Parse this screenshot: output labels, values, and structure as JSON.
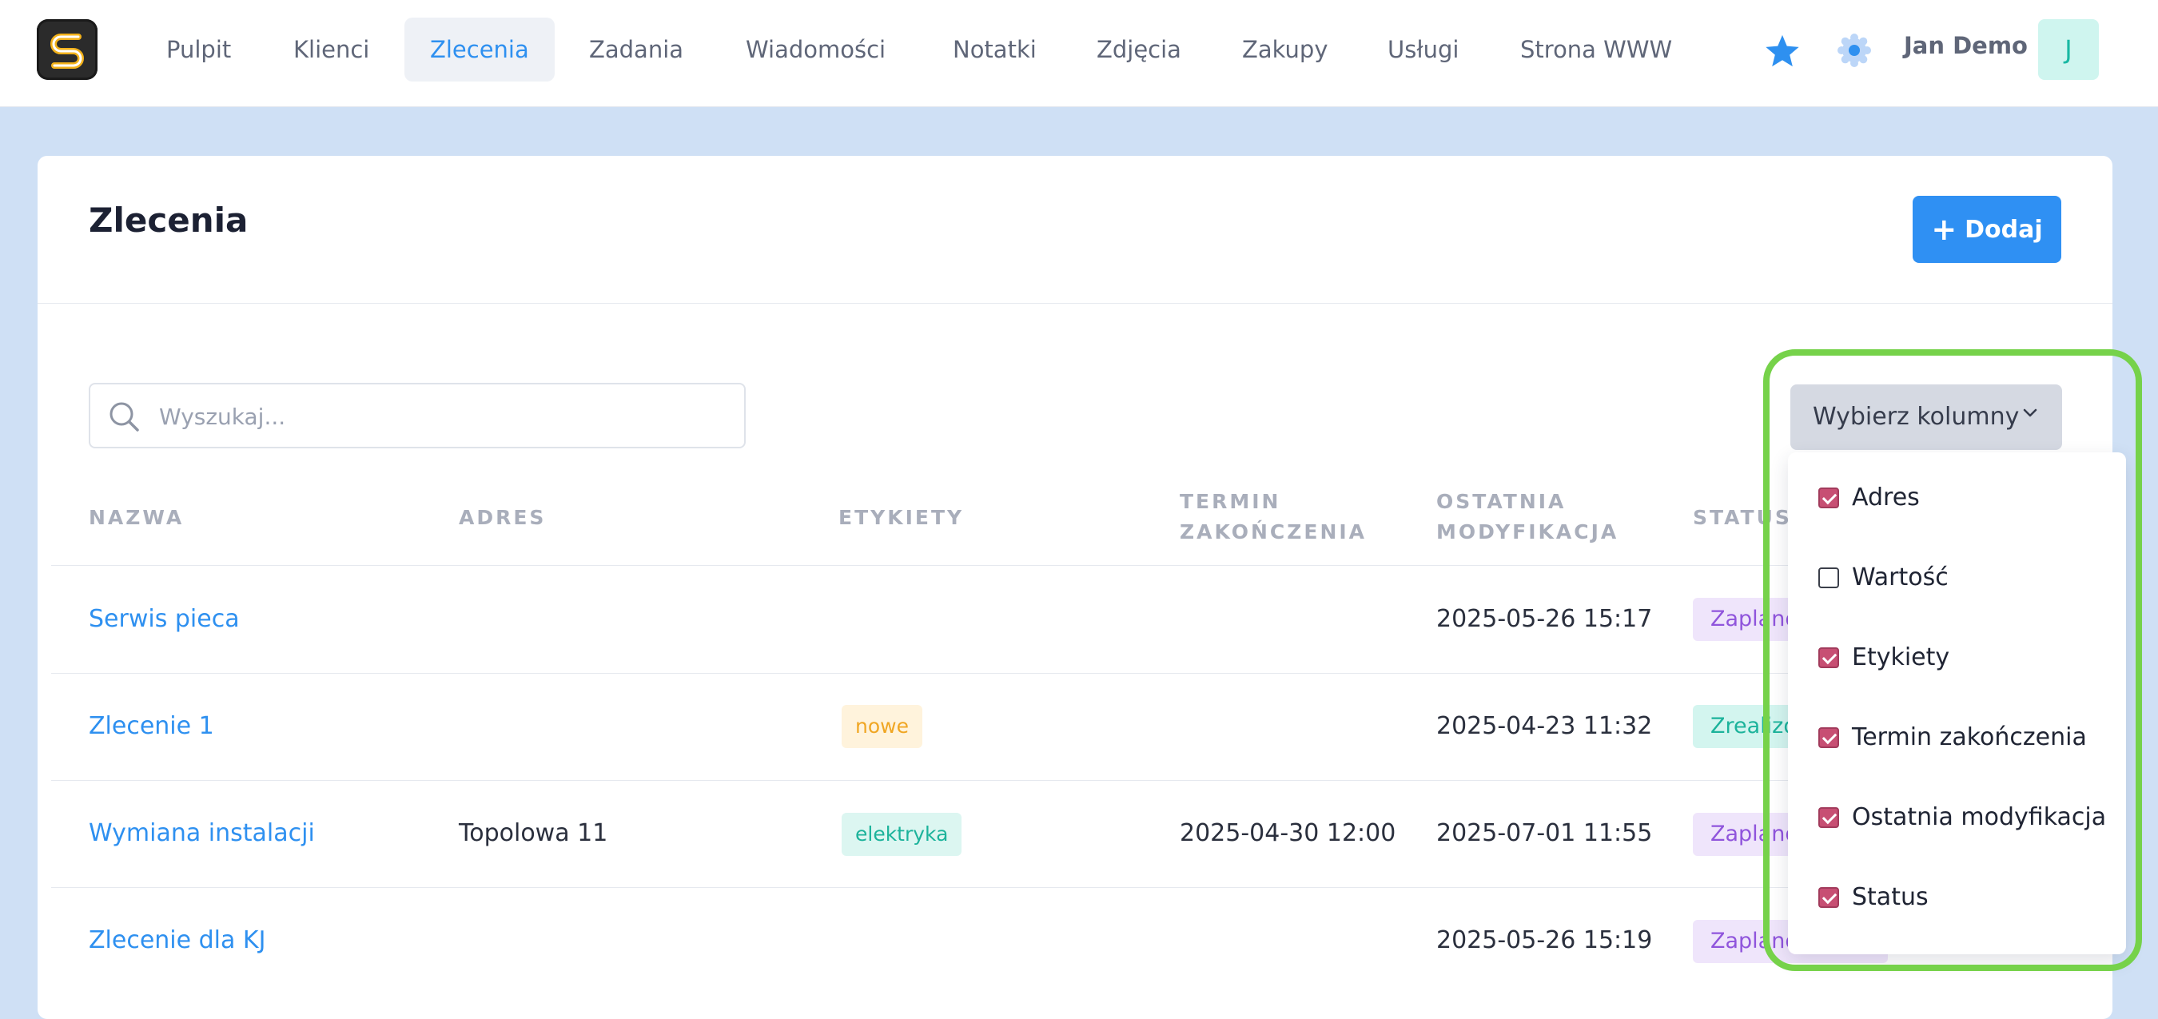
{
  "nav": {
    "items": [
      {
        "label": "Pulpit",
        "active": false
      },
      {
        "label": "Klienci",
        "active": false
      },
      {
        "label": "Zlecenia",
        "active": true
      },
      {
        "label": "Zadania",
        "active": false
      },
      {
        "label": "Wiadomości",
        "active": false
      },
      {
        "label": "Notatki",
        "active": false
      },
      {
        "label": "Zdjęcia",
        "active": false
      },
      {
        "label": "Zakupy",
        "active": false
      },
      {
        "label": "Usługi",
        "active": false
      },
      {
        "label": "Strona WWW",
        "active": false
      }
    ],
    "user_name": "Jan Demo",
    "avatar_initial": "J"
  },
  "page": {
    "title": "Zlecenia",
    "add_button_label": "Dodaj",
    "search_placeholder": "Wyszukaj...",
    "columns_button_label": "Wybierz kolumny"
  },
  "table": {
    "headers": {
      "name": "NAZWA",
      "address": "ADRES",
      "tags": "ETYKIETY",
      "deadline_line1": "TERMIN",
      "deadline_line2": "ZAKOŃCZENIA",
      "modified_line1": "OSTATNIA",
      "modified_line2": "MODYFIKACJA",
      "status": "STATUS"
    },
    "rows": [
      {
        "name": "Serwis pieca",
        "address": "",
        "tag": "",
        "deadline": "",
        "modified": "2025-05-26 15:17",
        "status": "Zaplanowane"
      },
      {
        "name": "Zlecenie 1",
        "address": "",
        "tag": "nowe",
        "deadline": "",
        "modified": "2025-04-23 11:32",
        "status": "Zrealizowane"
      },
      {
        "name": "Wymiana instalacji",
        "address": "Topolowa 11",
        "tag": "elektryka",
        "deadline": "2025-04-30 12:00",
        "modified": "2025-07-01 11:55",
        "status": "Zaplanowane"
      },
      {
        "name": "Zlecenie dla KJ",
        "address": "",
        "tag": "",
        "deadline": "",
        "modified": "2025-05-26 15:19",
        "status": "Zaplanowane"
      }
    ]
  },
  "column_chooser": {
    "options": [
      {
        "label": "Adres",
        "checked": true
      },
      {
        "label": "Wartość",
        "checked": false
      },
      {
        "label": "Etykiety",
        "checked": true
      },
      {
        "label": "Termin zakończenia",
        "checked": true
      },
      {
        "label": "Ostatnia modyfikacja",
        "checked": true
      },
      {
        "label": "Status",
        "checked": true
      }
    ]
  },
  "colors": {
    "accent": "#2e90f0",
    "highlight": "#76d24a",
    "checkbox_checked": "#c74f73",
    "tag_new_bg": "#fff3dc",
    "tag_new_text": "#f0a623",
    "tag_electric_bg": "#dcf6f1",
    "tag_electric_text": "#1cb39b",
    "status_planned_bg": "#efe5fb",
    "status_planned_text": "#9055dc",
    "status_done_bg": "#d3f5ef",
    "status_done_text": "#1cb39b"
  },
  "icons": {
    "logo": "s-logo",
    "favorites": "star-icon",
    "settings": "gear-icon",
    "search": "search-icon",
    "dropdown": "chevron-down-icon",
    "add": "plus-icon"
  }
}
